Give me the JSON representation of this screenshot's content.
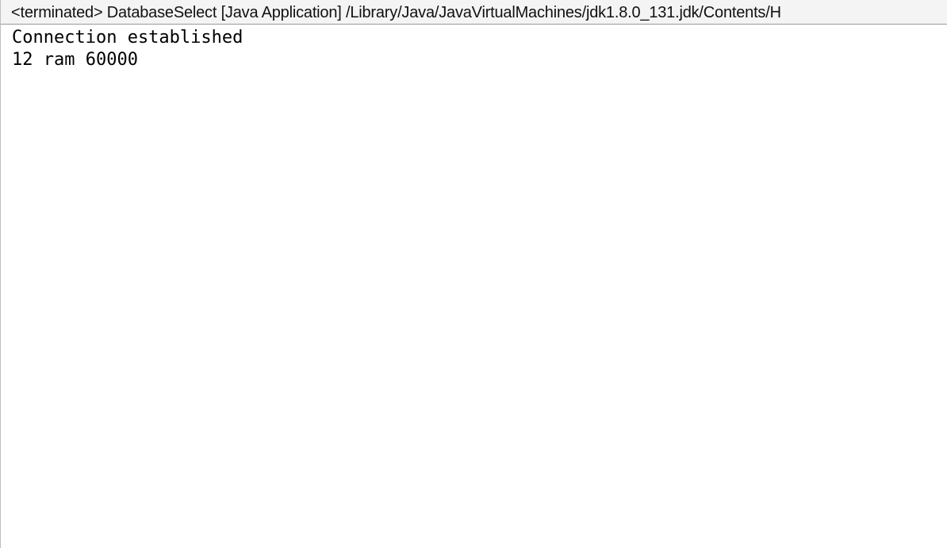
{
  "console": {
    "title": "<terminated> DatabaseSelect [Java Application] /Library/Java/JavaVirtualMachines/jdk1.8.0_131.jdk/Contents/H",
    "output_lines": [
      "Connection established",
      "12 ram 60000"
    ]
  }
}
